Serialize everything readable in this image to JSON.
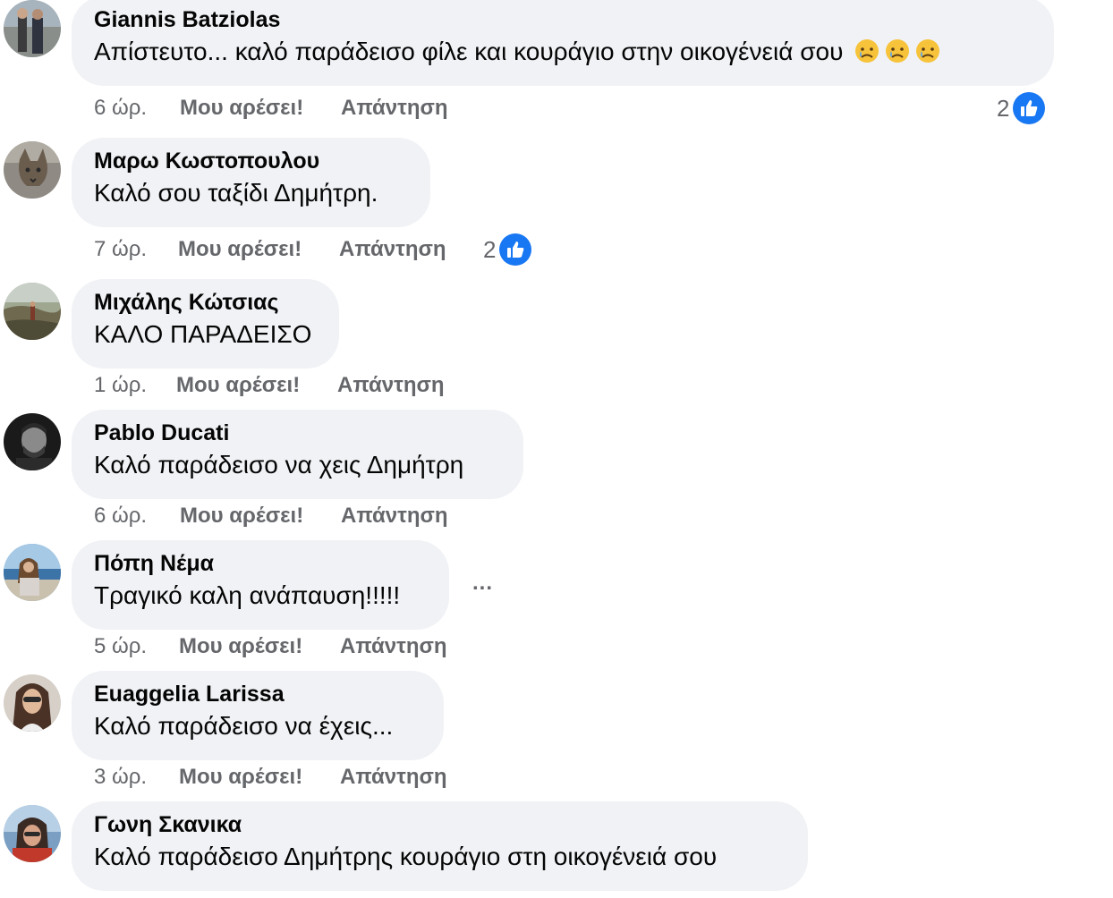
{
  "actions": {
    "like_label": "Μου αρέσει!",
    "reply_label": "Απάντηση"
  },
  "comments": [
    {
      "author": "Giannis Batziolas",
      "text": "Απίστευτο... καλό παράδεισο φίλε και κουράγιο στην οικογένειά σου",
      "emojis": [
        "sad-tear-face-emoji",
        "sad-tear-face-emoji",
        "sad-tear-face-emoji"
      ],
      "time": "6 ώρ.",
      "reaction_count": "2"
    },
    {
      "author": "Μαρω Κωστοπουλου",
      "text": "Καλό σου ταξίδι Δημήτρη.",
      "time": "7 ώρ.",
      "reaction_count": "2"
    },
    {
      "author": "Μιχάλης Κώτσιας",
      "text": "ΚΑΛΟ ΠΑΡΑΔΕΙΣΟ",
      "time": "1 ώρ."
    },
    {
      "author": "Pablo Ducati",
      "text": "Καλό παράδεισο να χεις Δημήτρη",
      "time": "6 ώρ."
    },
    {
      "author": "Πόπη Νέμα",
      "text": "Τραγικό καλη ανάπαυση!!!!!",
      "time": "5 ώρ.",
      "more_label": "..."
    },
    {
      "author": "Euaggelia Larissa",
      "text": "Καλό παράδεισο να έχεις...",
      "time": "3 ώρ."
    },
    {
      "author": "Γωνη Σκανικα",
      "text": "Καλό παράδεισο Δημήτρης κουράγιο στη οικογένειά σου"
    }
  ],
  "colors": {
    "bubble_bg": "#f0f2f5",
    "secondary_text": "#65676b",
    "like_blue": "#1877f2"
  }
}
